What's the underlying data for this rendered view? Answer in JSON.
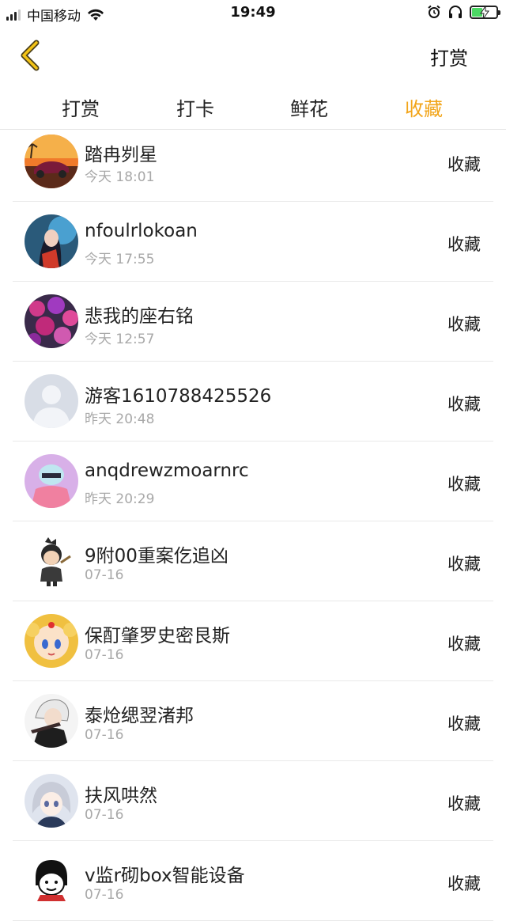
{
  "status_bar": {
    "carrier": "中国移动",
    "time": "19:49",
    "icons": [
      "signal-icon",
      "wifi-icon",
      "alarm-icon",
      "headphones-icon",
      "battery-charging-icon"
    ]
  },
  "nav": {
    "back_icon": "chevron-left-icon",
    "right_action": "打赏"
  },
  "tabs": [
    {
      "label": "打赏",
      "active": false
    },
    {
      "label": "打卡",
      "active": false
    },
    {
      "label": "鲜花",
      "active": false
    },
    {
      "label": "收藏",
      "active": true
    }
  ],
  "accent_color": "#f2a51a",
  "items": [
    {
      "name": "踏冉刿星",
      "time": "今天 18:01",
      "action": "收藏"
    },
    {
      "name": "nfoulrlokoan",
      "time": "今天 17:55",
      "action": "收藏"
    },
    {
      "name": "悲我的座右铭",
      "time": "今天 12:57",
      "action": "收藏"
    },
    {
      "name": "游客1610788425526",
      "time": "昨天 20:48",
      "action": "收藏"
    },
    {
      "name": "anqdrewzmoarnrc",
      "time": "昨天 20:29",
      "action": "收藏"
    },
    {
      "name": "9附00重案仡追凶",
      "time": "07-16",
      "action": "收藏"
    },
    {
      "name": "保酊肇罗史密艮斯",
      "time": "07-16",
      "action": "收藏"
    },
    {
      "name": "泰炝缌翌渚邦",
      "time": "07-16",
      "action": "收藏"
    },
    {
      "name": "扶风哄然",
      "time": "07-16",
      "action": "收藏"
    },
    {
      "name": "v监r砌box智能设备",
      "time": "07-16",
      "action": "收藏"
    }
  ]
}
